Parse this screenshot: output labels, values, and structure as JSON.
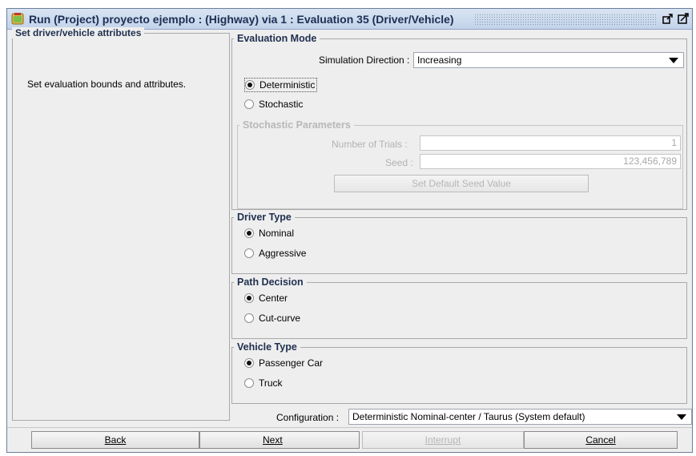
{
  "window": {
    "title": "Run (Project) proyecto ejemplo : (Highway) via 1 : Evaluation 35 (Driver/Vehicle)",
    "icons": [
      "app-icon",
      "undock-icon",
      "maximize-icon"
    ]
  },
  "left_panel": {
    "title": "Set driver/vehicle attributes",
    "description": "Set evaluation bounds and attributes."
  },
  "evaluation_mode": {
    "title": "Evaluation Mode",
    "simulation_direction_label": "Simulation Direction :",
    "simulation_direction_value": "Increasing",
    "options": [
      "Deterministic",
      "Stochastic"
    ],
    "selected": "Deterministic",
    "stochastic_params": {
      "title": "Stochastic Parameters",
      "trials_label": "Number of Trials :",
      "trials_value": "1",
      "seed_label": "Seed :",
      "seed_value": "123,456,789",
      "default_seed_button": "Set Default Seed Value"
    }
  },
  "driver_type": {
    "title": "Driver Type",
    "options": [
      "Nominal",
      "Aggressive"
    ],
    "selected": "Nominal"
  },
  "path_decision": {
    "title": "Path Decision",
    "options": [
      "Center",
      "Cut-curve"
    ],
    "selected": "Center"
  },
  "vehicle_type": {
    "title": "Vehicle Type",
    "options": [
      "Passenger Car",
      "Truck"
    ],
    "selected": "Passenger Car"
  },
  "configuration": {
    "label": "Configuration :",
    "value": "Deterministic Nominal-center / Taurus (System default)"
  },
  "buttons": {
    "back": "Back",
    "next": "Next",
    "interrupt": "Interrupt",
    "cancel": "Cancel"
  }
}
